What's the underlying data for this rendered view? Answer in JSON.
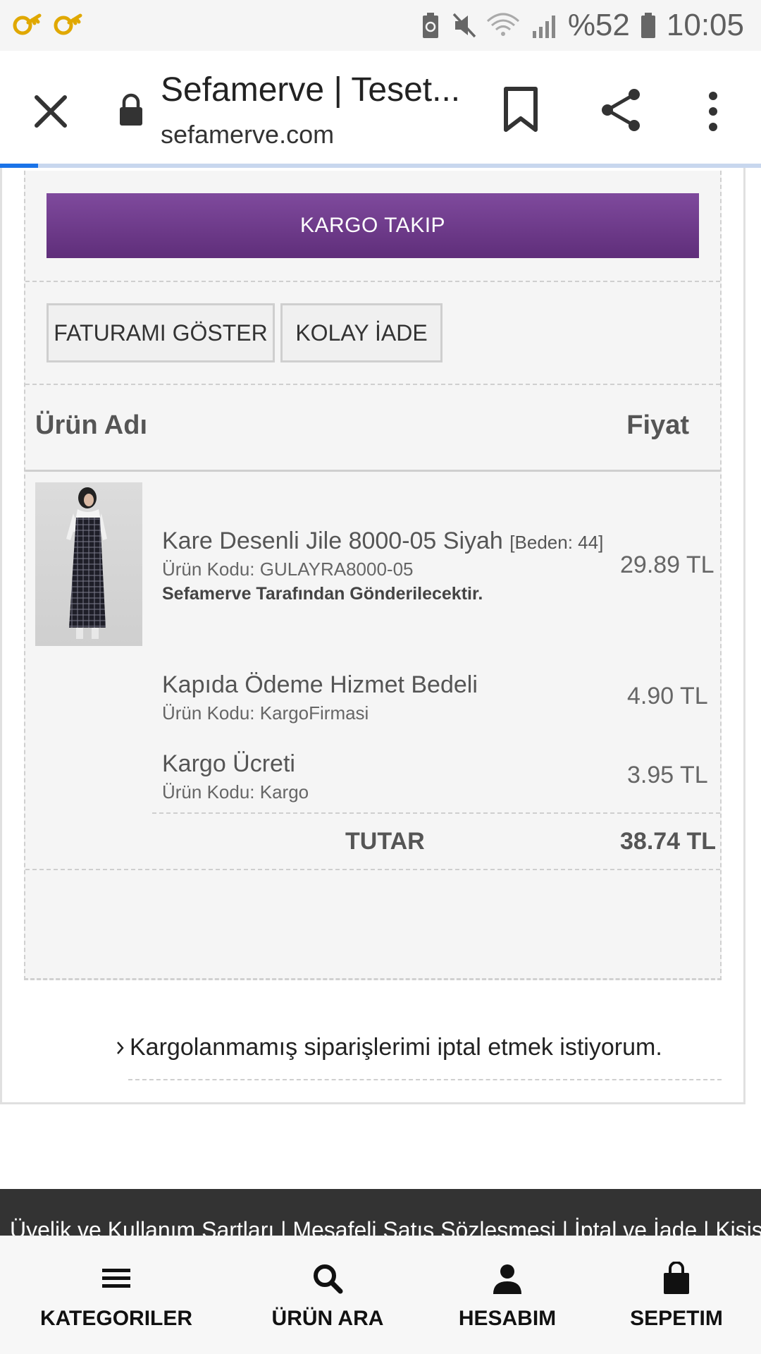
{
  "status_bar": {
    "battery": "%52",
    "time": "10:05"
  },
  "browser": {
    "title": "Sefamerve | Teset...",
    "url": "sefamerve.com"
  },
  "actions": {
    "kargo_takip": "KARGO TAKIP",
    "faturami_goster": "FATURAMI GÖSTER",
    "kolay_iade": "KOLAY İADE"
  },
  "table": {
    "header_name": "Ürün Adı",
    "header_price": "Fiyat",
    "items": [
      {
        "name": "Kare Desenli Jile 8000-05 Siyah",
        "size": "[Beden: 44]",
        "code": "Ürün Kodu: GULAYRA8000-05",
        "note": "Sefamerve Tarafından Gönderilecektir.",
        "price": "29.89 TL"
      },
      {
        "name": "Kapıda Ödeme Hizmet Bedeli",
        "code": "Ürün Kodu: KargoFirmasi",
        "price": "4.90 TL"
      },
      {
        "name": "Kargo Ücreti",
        "code": "Ürün Kodu: Kargo",
        "price": "3.95 TL"
      }
    ],
    "total_label": "TUTAR",
    "total_value": "38.74 TL"
  },
  "cancel_link": "Kargolanmamış siparişlerimi iptal etmek istiyorum.",
  "footer": {
    "links": "Üyelik ve Kullanım Şartları  |  Mesafeli Satış Sözleşmesi  |  İptal ve İade  |  Kişisel"
  },
  "bottom_nav": [
    {
      "label": "KATEGORILER",
      "icon": "menu-icon"
    },
    {
      "label": "ÜRÜN ARA",
      "icon": "search-icon"
    },
    {
      "label": "HESABIM",
      "icon": "user-icon"
    },
    {
      "label": "SEPETIM",
      "icon": "bag-icon"
    }
  ],
  "colors": {
    "primary_purple": "#6b3788",
    "footer_dark": "#333333",
    "progress_blue": "#1a73e8"
  }
}
